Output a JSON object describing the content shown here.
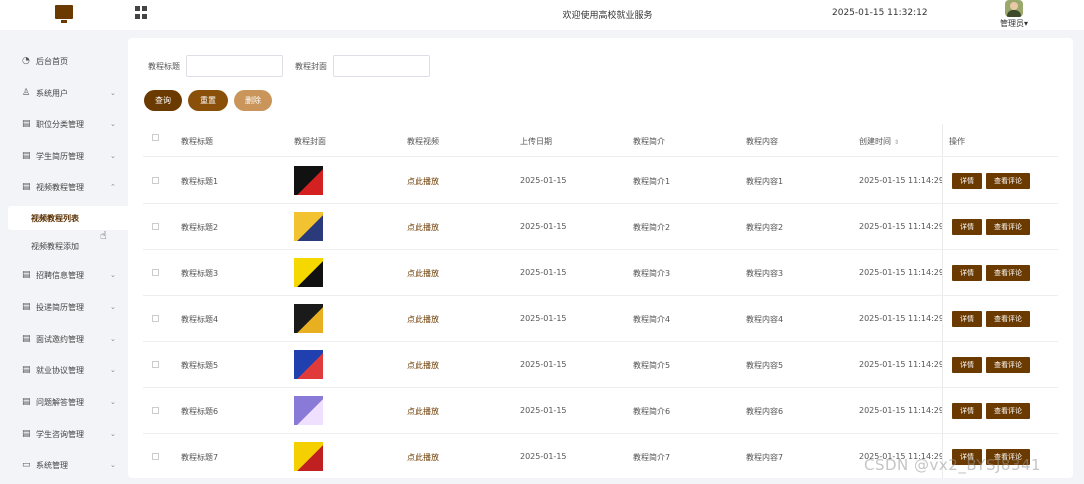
{
  "header": {
    "welcome": "欢迎使用高校就业服务",
    "datetime": "2025-01-15 11:32:12",
    "user_label": "管理员",
    "user_caret": "▾"
  },
  "sidebar": {
    "items": [
      {
        "label": "后台首页",
        "icon": "clock-icon",
        "glyph": "◔",
        "arrow": ""
      },
      {
        "label": "系统用户",
        "icon": "user-icon",
        "glyph": "♙",
        "arrow": "⌄"
      },
      {
        "label": "职位分类管理",
        "icon": "list-icon",
        "glyph": "▤",
        "arrow": "⌄"
      },
      {
        "label": "学生简历管理",
        "icon": "list-icon",
        "glyph": "▤",
        "arrow": "⌄"
      },
      {
        "label": "视频教程管理",
        "icon": "list-icon",
        "glyph": "▤",
        "arrow": "⌃"
      },
      {
        "label": "招聘信息管理",
        "icon": "list-icon",
        "glyph": "▤",
        "arrow": "⌄"
      },
      {
        "label": "投递简历管理",
        "icon": "list-icon",
        "glyph": "▤",
        "arrow": "⌄"
      },
      {
        "label": "面试邀约管理",
        "icon": "list-icon",
        "glyph": "▤",
        "arrow": "⌄"
      },
      {
        "label": "就业协议管理",
        "icon": "list-icon",
        "glyph": "▤",
        "arrow": "⌄"
      },
      {
        "label": "问题解答管理",
        "icon": "list-icon",
        "glyph": "▤",
        "arrow": "⌄"
      },
      {
        "label": "学生咨询管理",
        "icon": "list-icon",
        "glyph": "▤",
        "arrow": "⌄"
      },
      {
        "label": "系统管理",
        "icon": "folder-icon",
        "glyph": "▭",
        "arrow": "⌄"
      }
    ],
    "sub_items": [
      {
        "label": "视频教程列表"
      },
      {
        "label": "视频教程添加"
      }
    ]
  },
  "search": {
    "title_label": "教程标题",
    "title_value": "",
    "cover_label": "教程封面",
    "cover_value": ""
  },
  "buttons": {
    "search": "查询",
    "reset": "重置",
    "delete": "删除"
  },
  "table": {
    "columns": [
      "教程标题",
      "教程封面",
      "教程视频",
      "上传日期",
      "教程简介",
      "教程内容",
      "创建时间",
      "操作"
    ],
    "sort_glyph": "⇕",
    "detail_label": "详情",
    "comment_label": "查看评论",
    "rows": [
      {
        "title": "教程标题1",
        "video": "点此播放",
        "date": "2025-01-15",
        "intro": "教程简介1",
        "content": "教程内容1",
        "created": "2025-01-15 11:14:29",
        "cover_colors": [
          "#111111",
          "#d32020"
        ]
      },
      {
        "title": "教程标题2",
        "video": "点此播放",
        "date": "2025-01-15",
        "intro": "教程简介2",
        "content": "教程内容2",
        "created": "2025-01-15 11:14:29",
        "cover_colors": [
          "#f2c230",
          "#2a3a7a"
        ]
      },
      {
        "title": "教程标题3",
        "video": "点此播放",
        "date": "2025-01-15",
        "intro": "教程简介3",
        "content": "教程内容3",
        "created": "2025-01-15 11:14:29",
        "cover_colors": [
          "#f5d800",
          "#111111"
        ]
      },
      {
        "title": "教程标题4",
        "video": "点此播放",
        "date": "2025-01-15",
        "intro": "教程简介4",
        "content": "教程内容4",
        "created": "2025-01-15 11:14:29",
        "cover_colors": [
          "#1a1a1a",
          "#e8b020"
        ]
      },
      {
        "title": "教程标题5",
        "video": "点此播放",
        "date": "2025-01-15",
        "intro": "教程简介5",
        "content": "教程内容5",
        "created": "2025-01-15 11:14:29",
        "cover_colors": [
          "#2040b0",
          "#e03a3a"
        ]
      },
      {
        "title": "教程标题6",
        "video": "点此播放",
        "date": "2025-01-15",
        "intro": "教程简介6",
        "content": "教程内容6",
        "created": "2025-01-15 11:14:29",
        "cover_colors": [
          "#8a7ad8",
          "#f0e0ff"
        ]
      },
      {
        "title": "教程标题7",
        "video": "点此播放",
        "date": "2025-01-15",
        "intro": "教程简介7",
        "content": "教程内容7",
        "created": "2025-01-15 11:14:29",
        "cover_colors": [
          "#f5d000",
          "#c02020"
        ]
      }
    ]
  },
  "watermark": "CSDN @vx2_BYSJ8341",
  "colors": {
    "brand": "#6b3a00",
    "reset": "#8a5009",
    "delete": "#c9955a"
  }
}
